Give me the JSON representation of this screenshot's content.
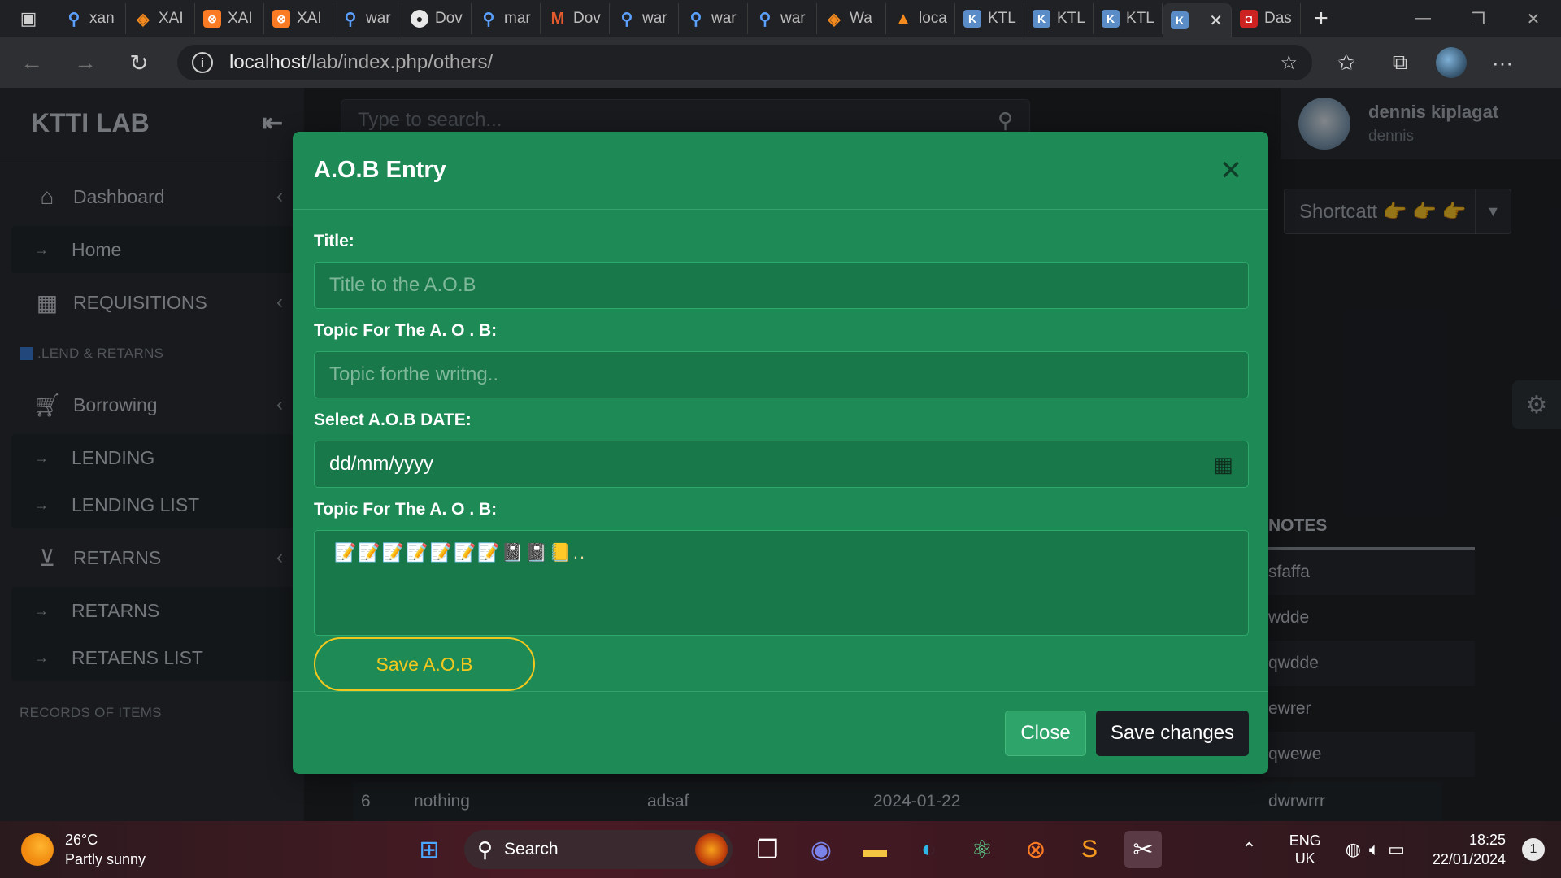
{
  "browser": {
    "tabs": [
      {
        "icon": "search-icon",
        "title": "xan"
      },
      {
        "icon": "orange-diamond-icon",
        "title": "XAI"
      },
      {
        "icon": "xampp-icon",
        "title": "XAI"
      },
      {
        "icon": "xampp-icon",
        "title": "XAI"
      },
      {
        "icon": "search-icon",
        "title": "war"
      },
      {
        "icon": "github-icon",
        "title": "Dov"
      },
      {
        "icon": "search-icon",
        "title": "mar"
      },
      {
        "icon": "mm-icon",
        "title": "Dov"
      },
      {
        "icon": "search-icon",
        "title": "war"
      },
      {
        "icon": "search-icon",
        "title": "war"
      },
      {
        "icon": "search-icon",
        "title": "war"
      },
      {
        "icon": "orange-diamond-icon",
        "title": "Wa"
      },
      {
        "icon": "laravel-icon",
        "title": "loca"
      },
      {
        "icon": "ktl-icon",
        "title": "KTL"
      },
      {
        "icon": "ktl-icon",
        "title": "KTL"
      },
      {
        "icon": "ktl-icon",
        "title": "KTL"
      },
      {
        "icon": "ktl-icon",
        "title": ""
      },
      {
        "icon": "pdf-icon",
        "title": "Das"
      }
    ],
    "url_host": "localhost",
    "url_path": "/lab/index.php/others/"
  },
  "sidebar": {
    "brand": "KTTI LAB",
    "dashboard": "Dashboard",
    "home": "Home",
    "requisitions": "REQUISITIONS",
    "lend_section": ".LEND & RETARNS",
    "borrowing": "Borrowing",
    "lending": "LENDING",
    "lending_list": "LENDING LIST",
    "retarns": "RETARNS",
    "retarns_sub": "RETARNS",
    "retaens_list": "RETAENS LIST",
    "records_section": "RECORDS OF ITEMS"
  },
  "header": {
    "search_placeholder": "Type to search...",
    "user_name": "dennis kiplagat",
    "user_handle": "dennis",
    "shortcut_label": "Shortcatt 👉 👉 👉"
  },
  "table": {
    "notes_header": "NOTES",
    "notes": [
      "sfaffa",
      "wdde",
      "qwdde",
      "ewrer",
      "qwewe"
    ],
    "last_row": {
      "num": "6",
      "col2": "nothing",
      "col3": "adsaf",
      "date": "2024-01-22",
      "notes": "dwrwrrr"
    }
  },
  "modal": {
    "title": "A.O.B Entry",
    "title_label": "Title:",
    "title_placeholder": "Title to the A.O.B",
    "topic_label": "Topic For The A. O . B:",
    "topic_placeholder": "Topic forthe writng..",
    "date_label": "Select A.O.B DATE:",
    "date_placeholder": "dd/mm/yyyy",
    "topic2_label": "Topic For The A. O . B:",
    "textarea_placeholder": "📝📝📝📝📝📝📝📓📓📒..",
    "save_aob": "Save A.O.B",
    "close": "Close",
    "save_changes": "Save changes"
  },
  "taskbar": {
    "temp": "26°C",
    "weather": "Partly sunny",
    "search": "Search",
    "lang1": "ENG",
    "lang2": "UK",
    "time": "18:25",
    "date": "22/01/2024",
    "notifications": "1"
  }
}
